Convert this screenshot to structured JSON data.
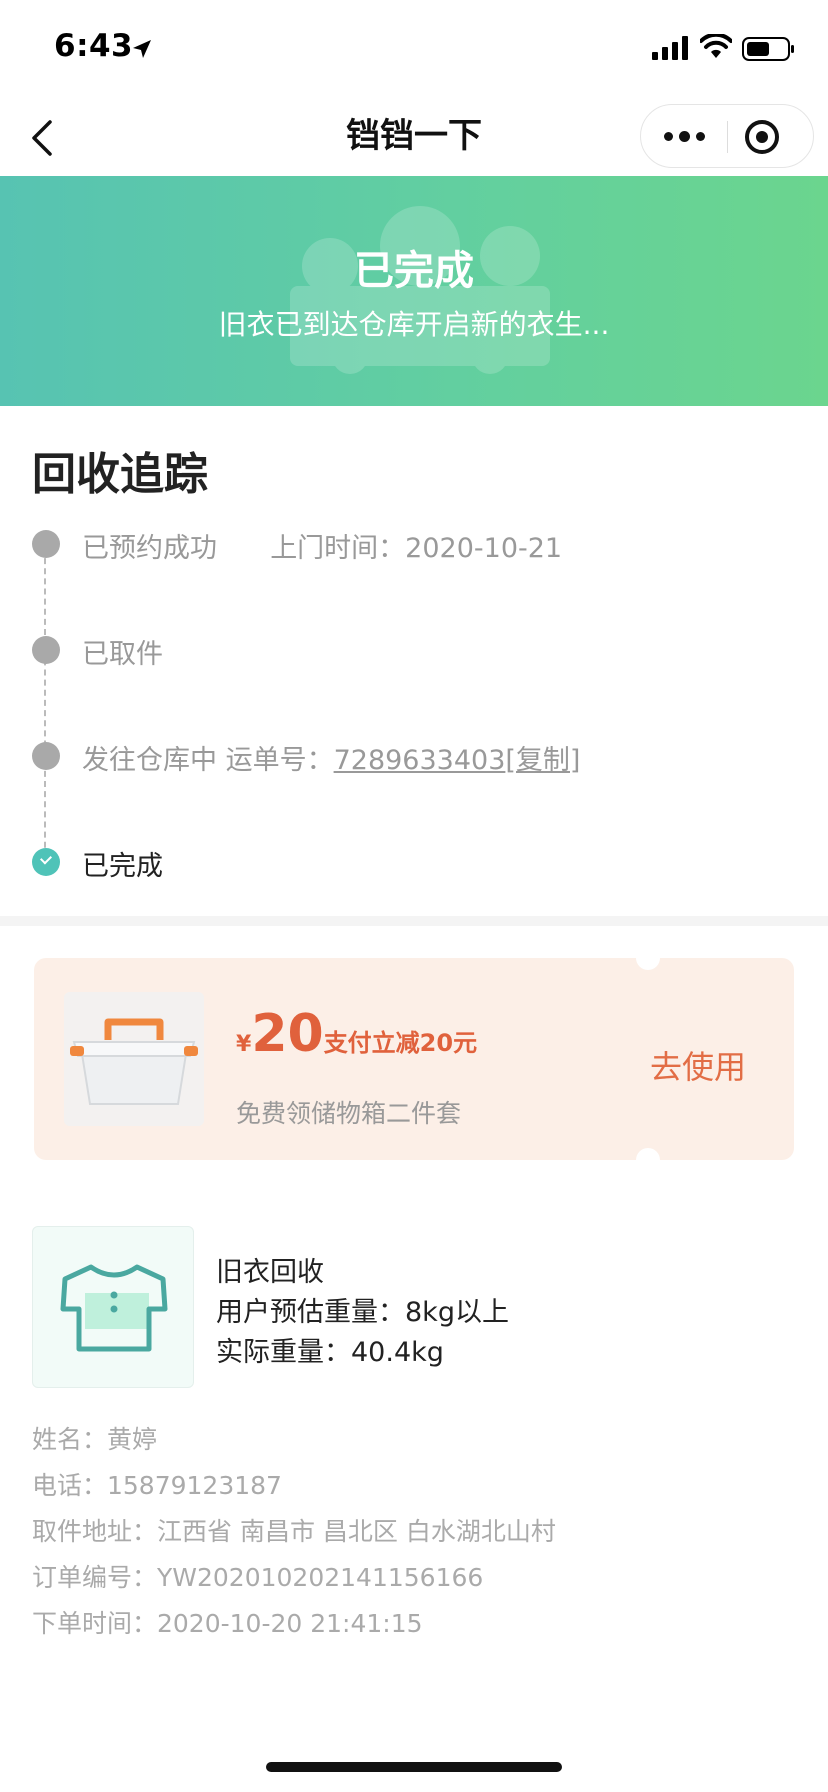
{
  "status_bar": {
    "time": "6:43"
  },
  "nav": {
    "title": "铛铛一下"
  },
  "banner": {
    "title": "已完成",
    "subtitle": "旧衣已到达仓库开启新的衣生..."
  },
  "tracking": {
    "title": "回收追踪",
    "steps": [
      {
        "label": "已预约成功",
        "extra": "上门时间：2020-10-21"
      },
      {
        "label": "已取件"
      },
      {
        "label": "发往仓库中 运单号：",
        "waybill": "7289633403",
        "copy": "[复制]"
      },
      {
        "label": "已完成"
      }
    ]
  },
  "coupon": {
    "currency": "¥",
    "amount": "20",
    "description": "支付立减20元",
    "subtitle": "免费领储物箱二件套",
    "button": "去使用"
  },
  "product": {
    "name": "旧衣回收",
    "estimated_weight": "用户预估重量：8kg以上",
    "actual_weight": "实际重量：40.4kg"
  },
  "order_info": {
    "name": "姓名：黄婷",
    "phone": "电话：15879123187",
    "address": "取件地址：江西省 南昌市 昌北区 白水湖北山村",
    "order_no": "订单编号：YW202010202141156166",
    "order_time": "下单时间：2020-10-20 21:41:15"
  },
  "colors": {
    "banner_start": "#57c3b2",
    "banner_end": "#6bd58e",
    "coupon_bg": "#fcefe7",
    "coupon_accent": "#e0613c",
    "done_dot": "#4fc3b8"
  }
}
